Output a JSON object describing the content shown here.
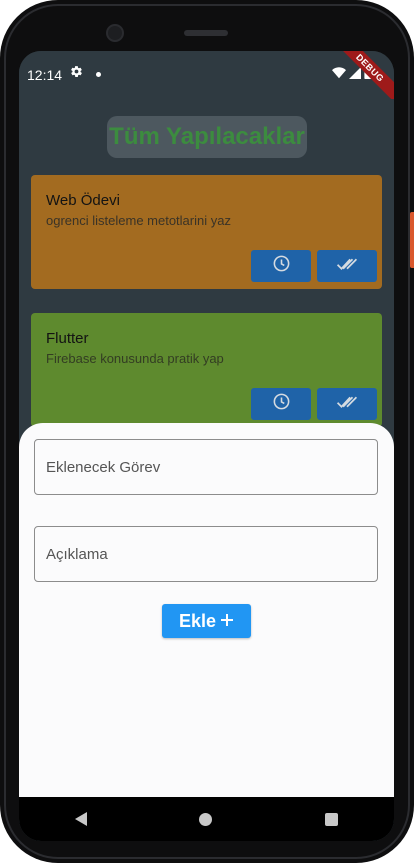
{
  "status_bar": {
    "time": "12:14",
    "settings_icon": "gear-icon",
    "wifi_icon": "wifi-icon",
    "signal_icon": "signal-icon",
    "battery_icon": "battery-icon"
  },
  "debug_banner": "DEBUG",
  "header": {
    "title": "Tüm Yapılacaklar"
  },
  "tasks": [
    {
      "title": "Web Ödevi",
      "description": "ogrenci listeleme metotlarini yaz",
      "color": "#a36b20"
    },
    {
      "title": "Flutter",
      "description": "Firebase konusunda pratik yap",
      "color": "#5e8a2e"
    }
  ],
  "task_actions": {
    "clock_icon": "clock-icon",
    "done_icon": "double-check-icon"
  },
  "sheet": {
    "task_field_placeholder": "Eklenecek Görev",
    "description_field_placeholder": "Açıklama",
    "add_button_label": "Ekle",
    "add_button_icon": "plus-icon"
  },
  "colors": {
    "title_text": "#3c8c3f",
    "button_blue": "#2196f3",
    "task_button_blue": "#1f63a8"
  }
}
